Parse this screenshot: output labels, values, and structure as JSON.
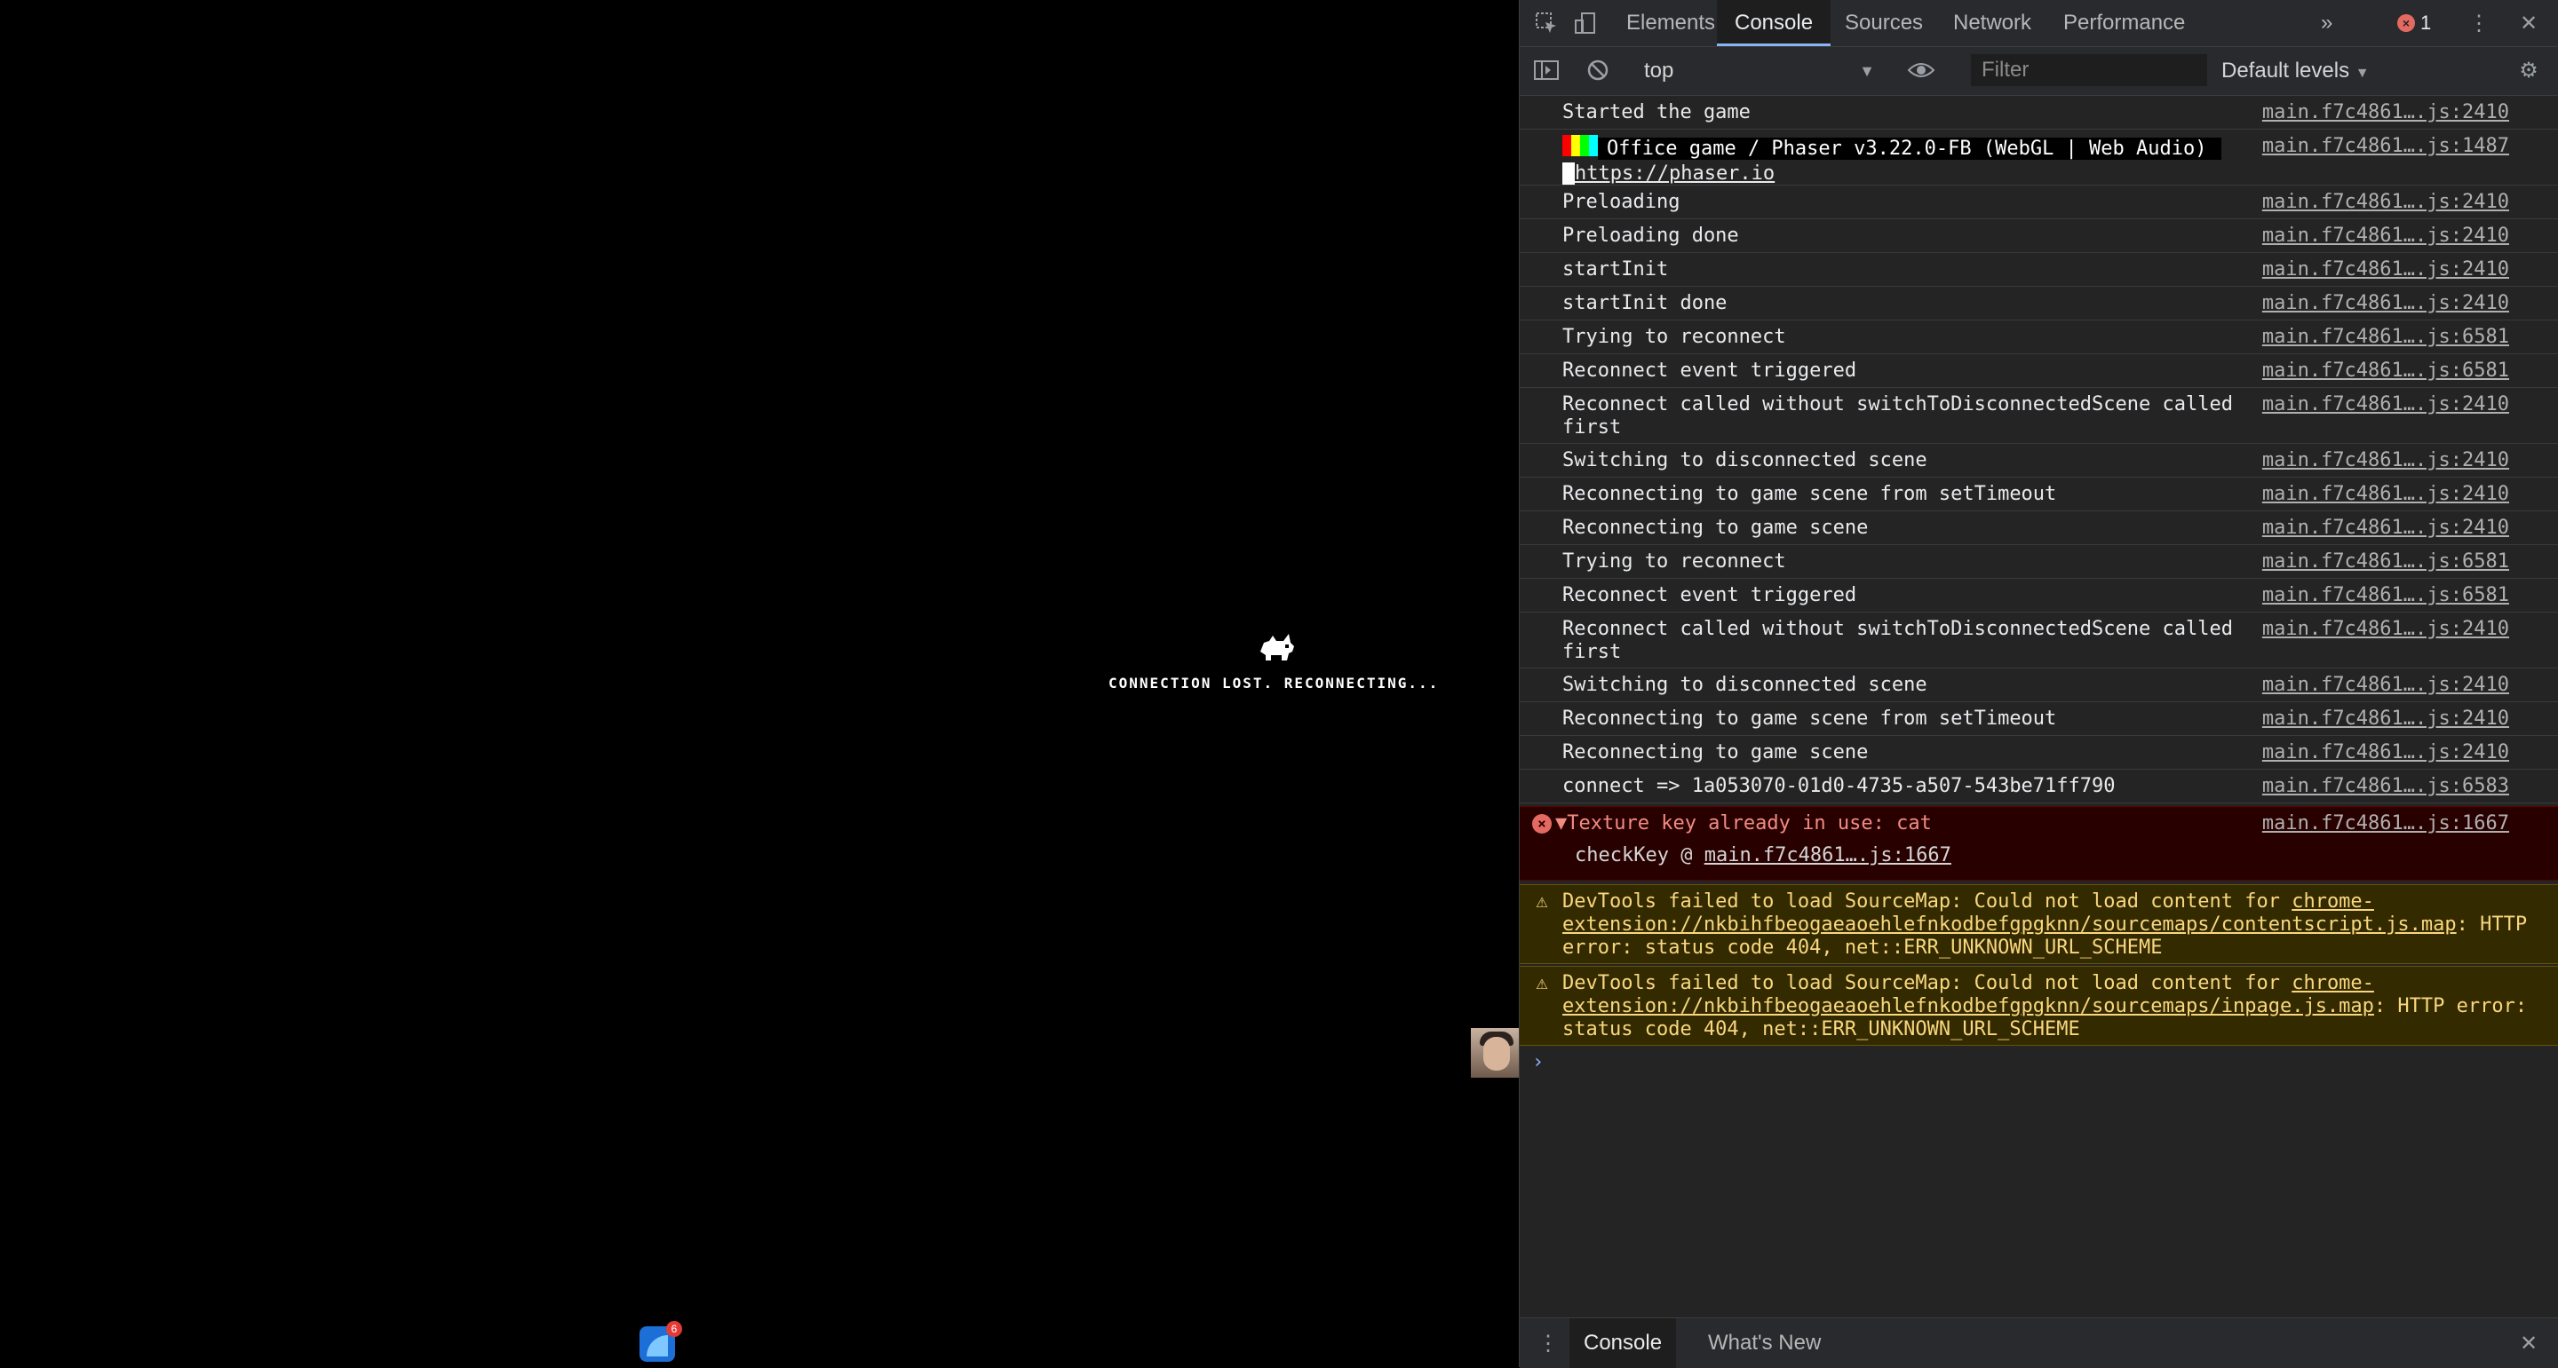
{
  "game": {
    "status_message": "CONNECTION LOST. RECONNECTING...",
    "dock_badge_count": "6"
  },
  "devtools": {
    "tabs": [
      "Elements",
      "Console",
      "Sources",
      "Network",
      "Performance"
    ],
    "active_tab": "Console",
    "more_tabs_icon": "»",
    "error_count": "1",
    "toolbar": {
      "context": "top",
      "filter_placeholder": "Filter",
      "levels": "Default levels"
    },
    "messages": [
      {
        "text": "Started the game",
        "source": "main.f7c4861….js:2410"
      },
      {
        "text": "Office game / Phaser v3.22.0-FB (WebGL | Web Audio)",
        "link": "https://phaser.io",
        "source": "main.f7c4861….js:1487"
      },
      {
        "text": "Preloading",
        "source": "main.f7c4861….js:2410"
      },
      {
        "text": "Preloading done",
        "source": "main.f7c4861….js:2410"
      },
      {
        "text": "startInit",
        "source": "main.f7c4861….js:2410"
      },
      {
        "text": "startInit done",
        "source": "main.f7c4861….js:2410"
      },
      {
        "text": "Trying to reconnect",
        "source": "main.f7c4861….js:6581"
      },
      {
        "text": "Reconnect event triggered",
        "source": "main.f7c4861….js:6581"
      },
      {
        "text": "Reconnect called without switchToDisconnectedScene called first",
        "source": "main.f7c4861….js:2410"
      },
      {
        "text": "Switching to disconnected scene",
        "source": "main.f7c4861….js:2410"
      },
      {
        "text": "Reconnecting to game scene from setTimeout",
        "source": "main.f7c4861….js:2410"
      },
      {
        "text": "Reconnecting to game scene",
        "source": "main.f7c4861….js:2410"
      },
      {
        "text": "Trying to reconnect",
        "source": "main.f7c4861….js:6581"
      },
      {
        "text": "Reconnect event triggered",
        "source": "main.f7c4861….js:6581"
      },
      {
        "text": "Reconnect called without switchToDisconnectedScene called first",
        "source": "main.f7c4861….js:2410"
      },
      {
        "text": "Switching to disconnected scene",
        "source": "main.f7c4861….js:2410"
      },
      {
        "text": "Reconnecting to game scene from setTimeout",
        "source": "main.f7c4861….js:2410"
      },
      {
        "text": "Reconnecting to game scene",
        "source": "main.f7c4861….js:2410"
      },
      {
        "text": "connect => 1a053070-01d0-4735-a507-543be71ff790",
        "source": "main.f7c4861….js:6583"
      }
    ],
    "error": {
      "text": "▼Texture key already in use: cat",
      "source": "main.f7c4861….js:1667",
      "stack_fn": "checkKey @ ",
      "stack_link": "main.f7c4861….js:1667"
    },
    "warnings": [
      {
        "prefix": "DevTools failed to load SourceMap: Could not load content for ",
        "link": "chrome-extension://nkbihfbeogaeaoehlefnkodbefgpgknn/sourcemaps/contentscript.js.map",
        "suffix": ": HTTP error: status code 404, net::ERR_UNKNOWN_URL_SCHEME"
      },
      {
        "prefix": "DevTools failed to load SourceMap: Could not load content for ",
        "link": "chrome-extension://nkbihfbeogaeaoehlefnkodbefgpgknn/sourcemaps/inpage.js.map",
        "suffix": ": HTTP error: status code 404, net::ERR_UNKNOWN_URL_SCHEME"
      }
    ],
    "prompt_symbol": "›",
    "drawer_tabs": [
      "Console",
      "What's New"
    ]
  }
}
